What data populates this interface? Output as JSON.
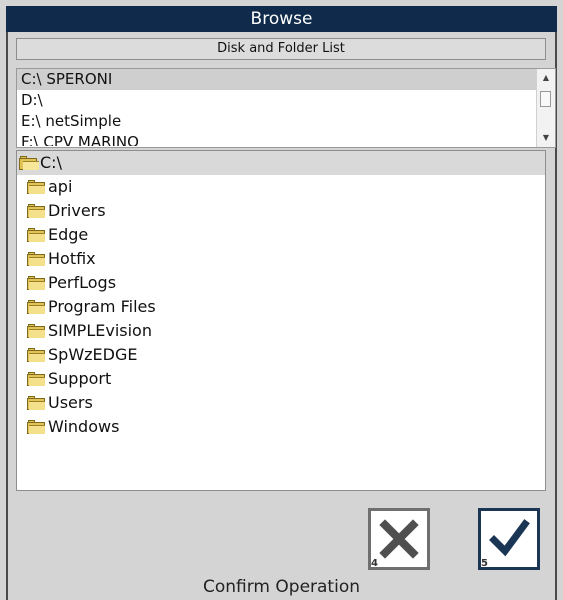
{
  "window": {
    "title": "Browse"
  },
  "disk_section": {
    "header": "Disk and Folder List"
  },
  "disks": [
    {
      "label": "C:\\ SPERONI",
      "selected": true
    },
    {
      "label": "D:\\",
      "selected": false
    },
    {
      "label": "E:\\ netSimple",
      "selected": false
    },
    {
      "label": "F:\\ CPV MARINO",
      "selected": false
    }
  ],
  "tree": {
    "root": "C:\\",
    "folders": [
      "api",
      "Drivers",
      "Edge",
      "Hotfix",
      "PerfLogs",
      "Program Files",
      "SIMPLEvision",
      "SpWzEDGE",
      "Support",
      "Users",
      "Windows"
    ]
  },
  "buttons": {
    "cancel_key": "4",
    "confirm_key": "5"
  },
  "status": {
    "label": "Confirm Operation"
  },
  "icons": {
    "cancel": "x-icon",
    "confirm": "check-icon",
    "folder": "folder-icon",
    "root": "open-folder-icon"
  },
  "colors": {
    "titlebar": "#0f2a4a",
    "confirm_border": "#1b3555",
    "background": "#d4d4d4"
  }
}
